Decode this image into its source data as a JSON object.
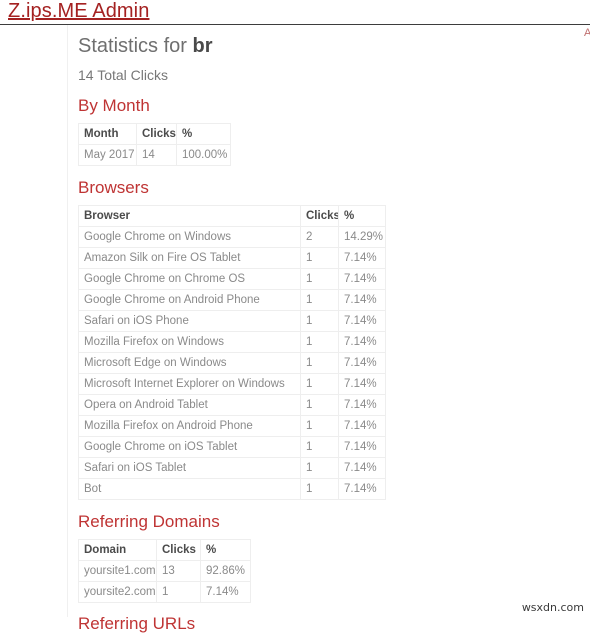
{
  "header": {
    "brand": "Z.ips.ME Admin",
    "right_link_clipped": "A"
  },
  "main": {
    "title_prefix": "Statistics for ",
    "title_slug": "br",
    "total_clicks": "14 Total Clicks",
    "sections": {
      "by_month": "By Month",
      "browsers": "Browsers",
      "referring_domains": "Referring Domains",
      "clipped_next": "Referring URLs"
    }
  },
  "by_month_table": {
    "columns": [
      "Month",
      "Clicks",
      "%"
    ],
    "rows": [
      [
        "May 2017",
        "14",
        "100.00%"
      ]
    ]
  },
  "browsers_table": {
    "columns": [
      "Browser",
      "Clicks",
      "%"
    ],
    "rows": [
      [
        "Google Chrome on Windows",
        "2",
        "14.29%"
      ],
      [
        "Amazon Silk on Fire OS Tablet",
        "1",
        "7.14%"
      ],
      [
        "Google Chrome on Chrome OS",
        "1",
        "7.14%"
      ],
      [
        "Google Chrome on Android Phone",
        "1",
        "7.14%"
      ],
      [
        "Safari on iOS Phone",
        "1",
        "7.14%"
      ],
      [
        "Mozilla Firefox on Windows",
        "1",
        "7.14%"
      ],
      [
        "Microsoft Edge on Windows",
        "1",
        "7.14%"
      ],
      [
        "Microsoft Internet Explorer on Windows",
        "1",
        "7.14%"
      ],
      [
        "Opera on Android Tablet",
        "1",
        "7.14%"
      ],
      [
        "Mozilla Firefox on Android Phone",
        "1",
        "7.14%"
      ],
      [
        "Google Chrome on iOS Tablet",
        "1",
        "7.14%"
      ],
      [
        "Safari on iOS Tablet",
        "1",
        "7.14%"
      ],
      [
        "Bot",
        "1",
        "7.14%"
      ]
    ]
  },
  "referring_domains_table": {
    "columns": [
      "Domain",
      "Clicks",
      "%"
    ],
    "rows": [
      [
        "yoursite1.com",
        "13",
        "92.86%"
      ],
      [
        "yoursite2.com",
        "1",
        "7.14%"
      ]
    ]
  },
  "watermark": {
    "text": "wsxdn.com"
  },
  "colors": {
    "brand": "#a42121",
    "section_heading": "#bf3434",
    "body_text": "#777777",
    "table_border": "#eeeeee",
    "navbar_rule": "#3d3d3d"
  }
}
